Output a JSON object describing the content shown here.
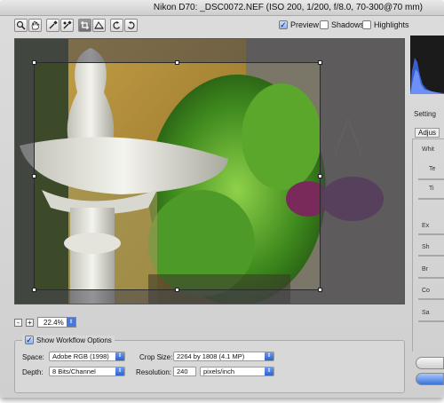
{
  "window": {
    "title": "Nikon D70:  _DSC0072.NEF  (ISO 200, 1/200, f/8.0, 70-300@70 mm)"
  },
  "toolbar": {
    "tools": [
      {
        "name": "zoom-tool-icon",
        "active": false
      },
      {
        "name": "hand-tool-icon",
        "active": false
      },
      {
        "name": "white-balance-eyedropper-icon",
        "active": false
      },
      {
        "name": "color-sampler-icon",
        "active": false
      },
      {
        "name": "crop-tool-icon",
        "active": true
      },
      {
        "name": "straighten-tool-icon",
        "active": false
      },
      {
        "name": "rotate-left-icon",
        "active": false
      },
      {
        "name": "rotate-right-icon",
        "active": false
      }
    ],
    "preview_label": "Preview",
    "preview_checked": true,
    "shadows_label": "Shadows",
    "shadows_checked": false,
    "highlights_label": "Highlights",
    "highlights_checked": false
  },
  "zoom": {
    "minus": "-",
    "plus": "+",
    "level": "22.4%"
  },
  "workflow": {
    "toggle_label": "Show Workflow Options",
    "toggle_checked": true,
    "space_label": "Space:",
    "space_value": "Adobe RGB (1998)",
    "depth_label": "Depth:",
    "depth_value": "8 Bits/Channel",
    "crop_size_label": "Crop Size:",
    "crop_size_value": "2264 by 1808  (4.1 MP)",
    "resolution_label": "Resolution:",
    "resolution_value": "240",
    "resolution_unit": "pixels/inch"
  },
  "right_panel": {
    "settings_label": "Setting",
    "adjust_tab": "Adjus",
    "white_balance": "Whit",
    "temperature": "Te",
    "tint": "Ti",
    "exposure": "Ex",
    "shadows": "Sh",
    "brightness": "Br",
    "contrast": "Co",
    "saturation": "Sa"
  }
}
